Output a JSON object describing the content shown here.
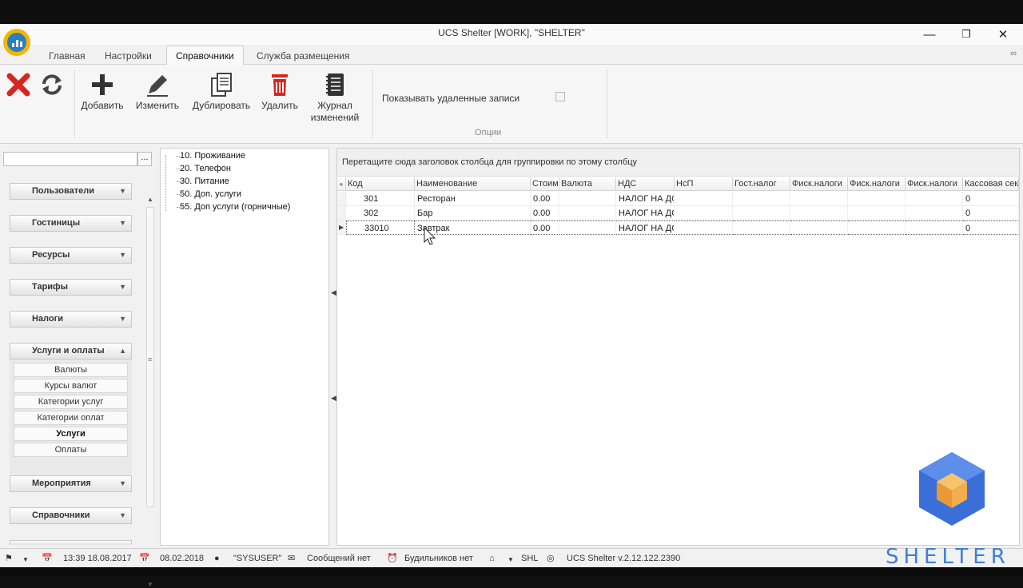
{
  "window": {
    "title": "UCS Shelter [WORK], \"SHELTER\""
  },
  "tabs": [
    {
      "label": "Главная"
    },
    {
      "label": "Настройки"
    },
    {
      "label": "Справочники"
    },
    {
      "label": "Служба размещения"
    }
  ],
  "active_tab": "Справочники",
  "ribbon": {
    "buttons": [
      {
        "label": "Добавить",
        "icon": "plus-icon"
      },
      {
        "label": "Изменить",
        "icon": "pencil-icon"
      },
      {
        "label": "Дублировать",
        "icon": "duplicate-icon"
      },
      {
        "label": "Удалить",
        "icon": "trash-icon"
      },
      {
        "label": "Журнал изменений",
        "icon": "journal-icon"
      }
    ],
    "close_icon": "close-red-icon",
    "refresh_icon": "refresh-icon",
    "options": {
      "show_deleted_label": "Показывать удаленные записи",
      "show_deleted_checked": false,
      "group_label": "Опции"
    }
  },
  "sidebar": {
    "search_value": "",
    "search_more": "...",
    "groups_top": [
      "Пользователи",
      "Гостиницы",
      "Ресурсы",
      "Тарифы",
      "Налоги"
    ],
    "expanded_group": "Услуги и оплаты",
    "sub_items": [
      "Валюты",
      "Курсы валют",
      "Категории услуг",
      "Категории оплат",
      "Услуги",
      "Оплаты"
    ],
    "active_sub_item": "Услуги",
    "groups_bottom": [
      "Мероприятия",
      "Справочники"
    ]
  },
  "tree": {
    "items": [
      "10. Проживание",
      "20. Телефон",
      "30. Питание",
      "50. Доп. услуги",
      "55. Доп услуги (горничные)"
    ]
  },
  "grid": {
    "group_hint": "Перетащите сюда заголовок столбца для группировки по этому столбцу",
    "columns": [
      "Код",
      "Наименование",
      "Стоим",
      "Валюта",
      "НДС",
      "НсП",
      "Гост.налог",
      "Фиск.налоги",
      "Фиск.налоги",
      "Фиск.налоги",
      "Кассовая сек"
    ],
    "rows": [
      [
        "301",
        "Ресторан",
        "0.00",
        "",
        "НАЛОГ НА ДС",
        "",
        "",
        "",
        "",
        "",
        "0"
      ],
      [
        "302",
        "Бар",
        "0.00",
        "",
        "НАЛОГ НА ДС",
        "",
        "",
        "",
        "",
        "",
        "0"
      ],
      [
        "33010",
        "Завтрак",
        "0.00",
        "",
        "НАЛОГ НА ДС",
        "",
        "",
        "",
        "",
        "",
        "0"
      ]
    ],
    "selected_row": 2
  },
  "status": {
    "datetime1": "13:39 18.08.2017",
    "date2": "08.02.2018",
    "user": "\"SYSUSER\"",
    "messages": "Сообщений нет",
    "alarms": "Будильников нет",
    "hotel": "SHL",
    "version": "UCS Shelter v.2.12.122.2390"
  },
  "brand": {
    "text": "SHELTER",
    "colors": {
      "top": "#f2a33a",
      "cube": "#3a6fd8"
    }
  },
  "colors": {
    "accent": "#3a6fd8",
    "delete": "#d9261c",
    "logo": "#f2b705"
  }
}
